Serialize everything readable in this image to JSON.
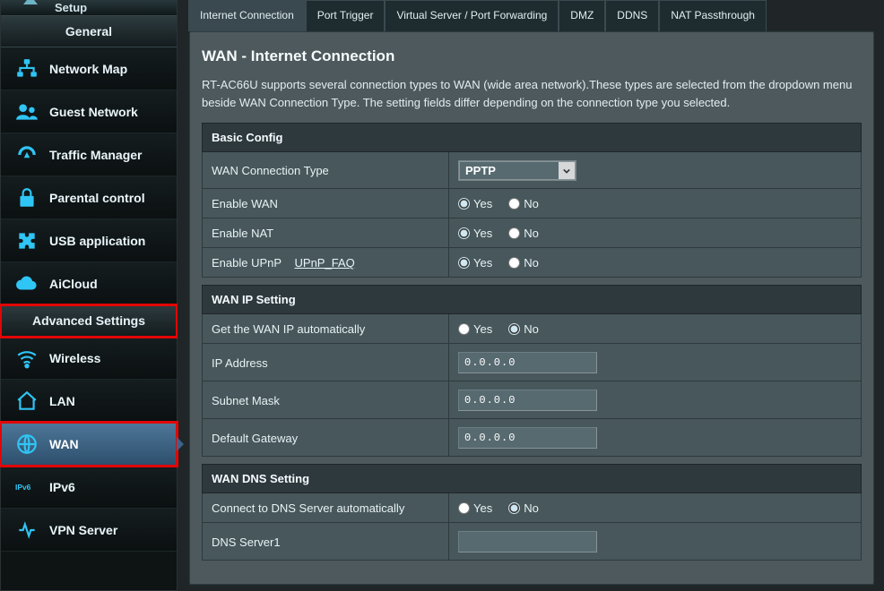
{
  "sidebar": {
    "setup_label": "Setup",
    "general_label": "General",
    "advanced_label": "Advanced Settings",
    "items_general": [
      {
        "label": "Network Map"
      },
      {
        "label": "Guest Network"
      },
      {
        "label": "Traffic Manager"
      },
      {
        "label": "Parental control"
      },
      {
        "label": "USB application"
      },
      {
        "label": "AiCloud"
      }
    ],
    "items_advanced": [
      {
        "label": "Wireless"
      },
      {
        "label": "LAN"
      },
      {
        "label": "WAN"
      },
      {
        "label": "IPv6"
      },
      {
        "label": "VPN Server"
      }
    ]
  },
  "tabs": [
    {
      "label": "Internet Connection"
    },
    {
      "label": "Port Trigger"
    },
    {
      "label": "Virtual Server / Port Forwarding"
    },
    {
      "label": "DMZ"
    },
    {
      "label": "DDNS"
    },
    {
      "label": "NAT Passthrough"
    }
  ],
  "page": {
    "title": "WAN - Internet Connection",
    "description": "RT-AC66U supports several connection types to WAN (wide area network).These types are selected from the dropdown menu beside WAN Connection Type. The setting fields differ depending on the connection type you selected."
  },
  "sections": {
    "basic": {
      "header": "Basic Config",
      "wan_conn_type_label": "WAN Connection Type",
      "wan_conn_type_value": "PPTP",
      "enable_wan_label": "Enable WAN",
      "enable_nat_label": "Enable NAT",
      "enable_upnp_label": "Enable UPnP",
      "upnp_faq_link": "UPnP_FAQ"
    },
    "wanip": {
      "header": "WAN IP Setting",
      "auto_ip_label": "Get the WAN IP automatically",
      "ip_label": "IP Address",
      "ip_value": "0.0.0.0",
      "mask_label": "Subnet Mask",
      "mask_value": "0.0.0.0",
      "gw_label": "Default Gateway",
      "gw_value": "0.0.0.0"
    },
    "dns": {
      "header": "WAN DNS Setting",
      "auto_dns_label": "Connect to DNS Server automatically",
      "dns1_label": "DNS Server1",
      "dns1_value": ""
    }
  },
  "common": {
    "yes": "Yes",
    "no": "No"
  }
}
